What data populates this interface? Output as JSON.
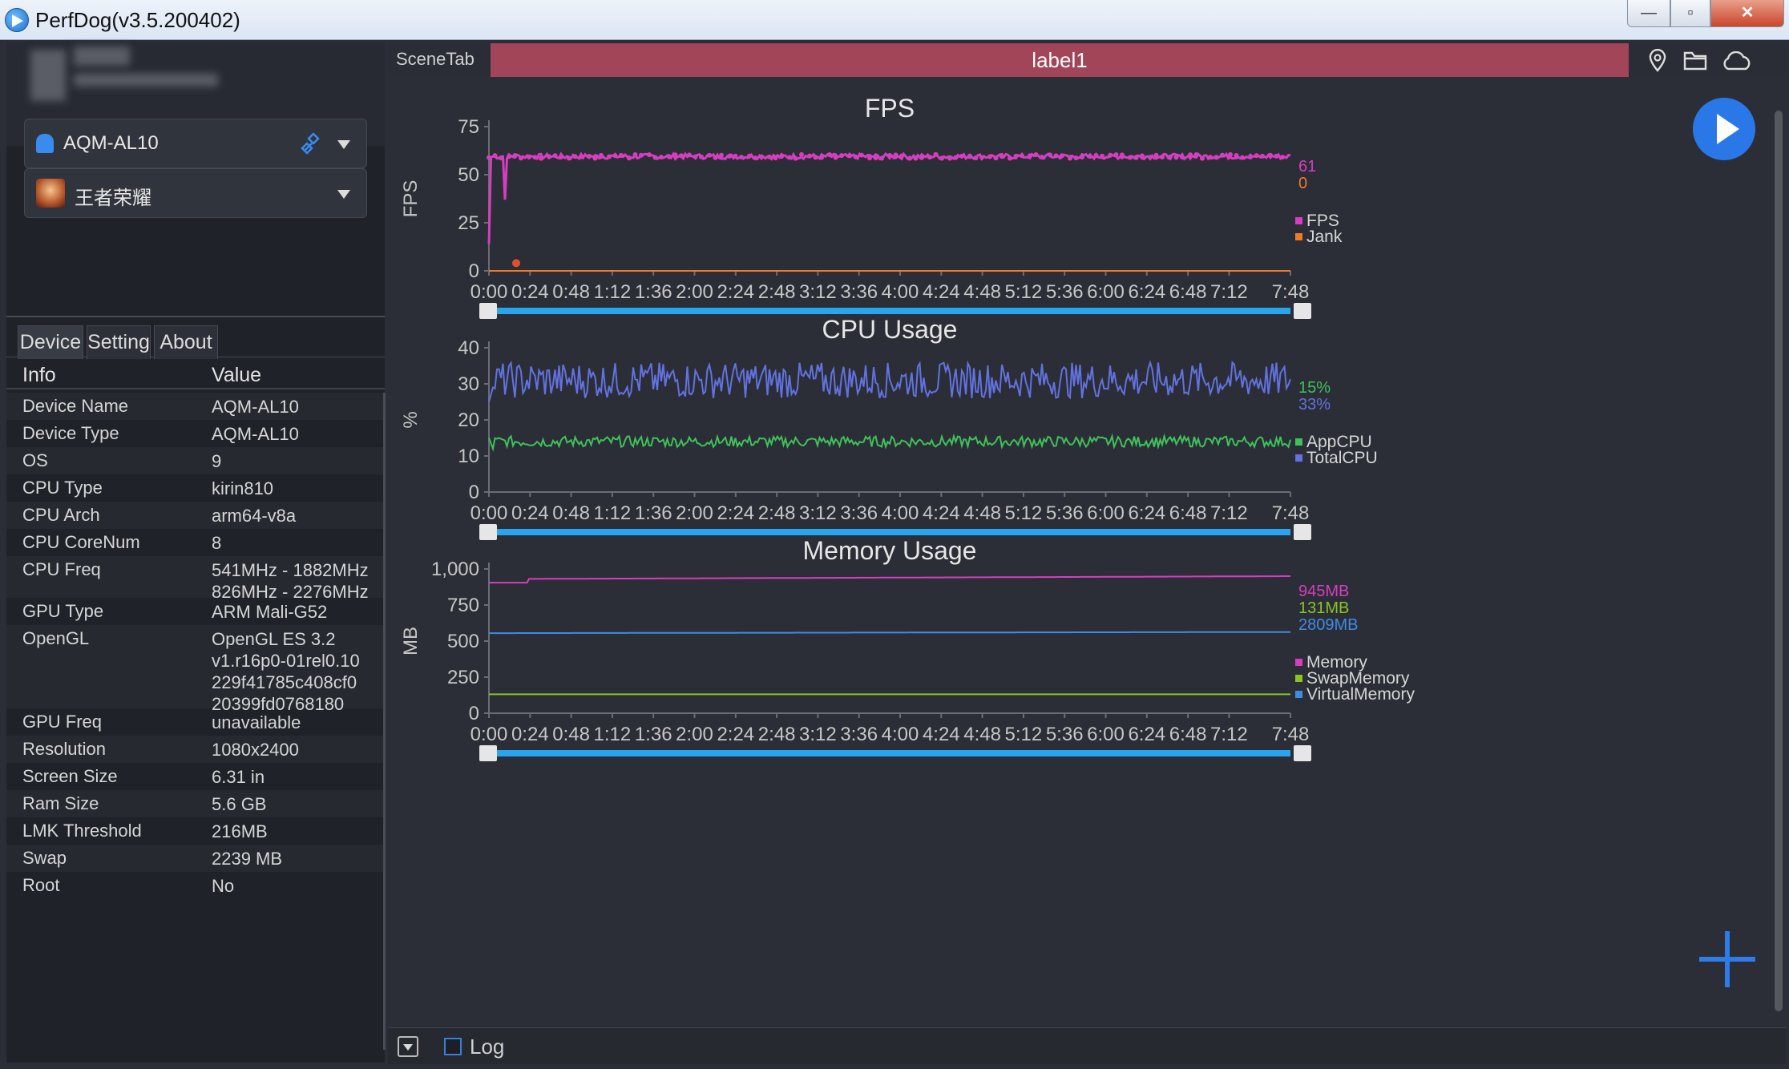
{
  "window": {
    "title": "PerfDog(v3.5.200402)",
    "min": "—",
    "max": "▫",
    "close": "✕"
  },
  "left": {
    "device_dropdown": "AQM-AL10",
    "app_dropdown": "王者荣耀",
    "tabs": [
      "Device",
      "Setting",
      "About"
    ],
    "table_header": [
      "Info",
      "Value"
    ],
    "rows": [
      {
        "k": "Device Name",
        "v": "AQM-AL10"
      },
      {
        "k": "Device Type",
        "v": "AQM-AL10"
      },
      {
        "k": "OS",
        "v": "9"
      },
      {
        "k": "CPU Type",
        "v": "kirin810"
      },
      {
        "k": "CPU Arch",
        "v": "arm64-v8a"
      },
      {
        "k": "CPU CoreNum",
        "v": "8"
      },
      {
        "k": "CPU Freq",
        "v": "541MHz - 1882MHz\n826MHz - 2276MHz"
      },
      {
        "k": "GPU Type",
        "v": "ARM Mali-G52"
      },
      {
        "k": "OpenGL",
        "v": "OpenGL ES 3.2\nv1.r16p0-01rel0.10\n229f41785c408cf0\n20399fd0768180"
      },
      {
        "k": "GPU Freq",
        "v": "unavailable"
      },
      {
        "k": "Resolution",
        "v": "1080x2400"
      },
      {
        "k": "Screen Size",
        "v": "6.31 in"
      },
      {
        "k": "Ram Size",
        "v": "5.6 GB"
      },
      {
        "k": "LMK Threshold",
        "v": "216MB"
      },
      {
        "k": "Swap",
        "v": "2239 MB"
      },
      {
        "k": "Root",
        "v": "No"
      }
    ]
  },
  "main": {
    "scene_tab": "SceneTab",
    "label": "label1",
    "log_label": "Log"
  },
  "chart_data": [
    {
      "type": "line",
      "title": "FPS",
      "ylabel": "FPS",
      "ylim": [
        0,
        75
      ],
      "yticks": [
        0,
        25,
        50,
        75
      ],
      "x": [
        "0:00",
        "0:24",
        "0:48",
        "1:12",
        "1:36",
        "2:00",
        "2:24",
        "2:48",
        "3:12",
        "3:36",
        "4:00",
        "4:24",
        "4:48",
        "5:12",
        "5:36",
        "6:00",
        "6:24",
        "6:48",
        "7:12",
        "7:48"
      ],
      "series": [
        {
          "name": "FPS",
          "color": "#d63ec0",
          "current": "61",
          "approx": "≈60 steady after start, dip to ~37 near 0:12"
        },
        {
          "name": "Jank",
          "color": "#f07a2a",
          "current": "0"
        }
      ]
    },
    {
      "type": "line",
      "title": "CPU Usage",
      "ylabel": "%",
      "ylim": [
        0,
        40
      ],
      "yticks": [
        0,
        10,
        20,
        30,
        40
      ],
      "x": [
        "0:00",
        "0:24",
        "0:48",
        "1:12",
        "1:36",
        "2:00",
        "2:24",
        "2:48",
        "3:12",
        "3:36",
        "4:00",
        "4:24",
        "4:48",
        "5:12",
        "5:36",
        "6:00",
        "6:24",
        "6:48",
        "7:12",
        "7:48"
      ],
      "series": [
        {
          "name": "AppCPU",
          "color": "#3ec25a",
          "current": "15%"
        },
        {
          "name": "TotalCPU",
          "color": "#6272e0",
          "current": "33%"
        }
      ]
    },
    {
      "type": "line",
      "title": "Memory Usage",
      "ylabel": "MB",
      "ylim": [
        0,
        1000
      ],
      "yticks": [
        "0",
        "250",
        "500",
        "750",
        "1,000"
      ],
      "x": [
        "0:00",
        "0:24",
        "0:48",
        "1:12",
        "1:36",
        "2:00",
        "2:24",
        "2:48",
        "3:12",
        "3:36",
        "4:00",
        "4:24",
        "4:48",
        "5:12",
        "5:36",
        "6:00",
        "6:24",
        "6:48",
        "7:12",
        "7:48"
      ],
      "series": [
        {
          "name": "Memory",
          "color": "#d63ec0",
          "current": "945MB"
        },
        {
          "name": "SwapMemory",
          "color": "#8ac424",
          "current": "131MB"
        },
        {
          "name": "VirtualMemory",
          "color": "#3f8be8",
          "current": "2809MB"
        }
      ]
    }
  ]
}
